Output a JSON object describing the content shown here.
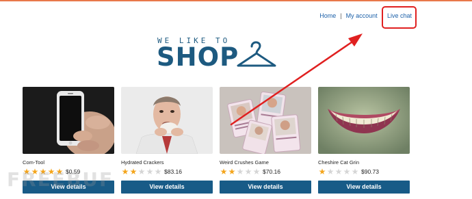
{
  "nav": {
    "home": "Home",
    "sep1": "|",
    "my_account": "My account",
    "sep2": "|",
    "live_chat": "Live chat"
  },
  "logo": {
    "tagline": "WE LIKE TO",
    "word": "SHOP"
  },
  "products": [
    {
      "name": "Com-Tool",
      "rating": 5,
      "price": "$0.59",
      "button": "View details"
    },
    {
      "name": "Hydrated Crackers",
      "rating": 2,
      "price": "$83.16",
      "button": "View details"
    },
    {
      "name": "Weird Crushes Game",
      "rating": 2,
      "price": "$70.16",
      "button": "View details"
    },
    {
      "name": "Cheshire Cat Grin",
      "rating": 1,
      "price": "$90.73",
      "button": "View details"
    }
  ],
  "annotation": {
    "highlight_color": "#e02020",
    "highlighted_element": "Live chat"
  },
  "colors": {
    "brand": "#1d5a80",
    "button": "#185b87",
    "link": "#1a5fa8",
    "star": "#f4a51c",
    "top_border": "#e8784a"
  },
  "watermark": "FREEBUF"
}
